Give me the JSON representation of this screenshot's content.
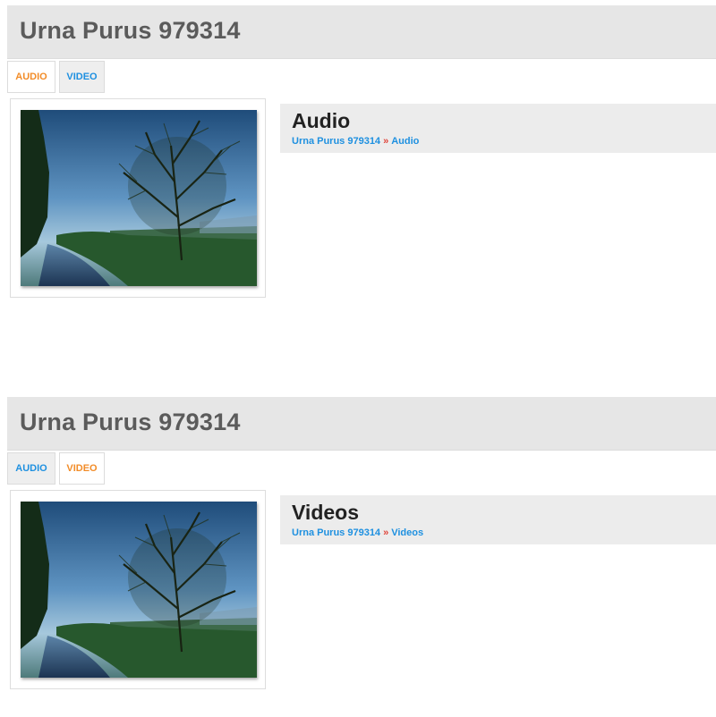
{
  "panels": [
    {
      "title": "Urna Purus 979314",
      "tabs": [
        {
          "label": "AUDIO",
          "active": true
        },
        {
          "label": "VIDEO",
          "active": false
        }
      ],
      "section_title": "Audio",
      "breadcrumb": {
        "home": "Urna Purus 979314",
        "separator": "»",
        "current": "Audio"
      }
    },
    {
      "title": "Urna Purus 979314",
      "tabs": [
        {
          "label": "AUDIO",
          "active": false
        },
        {
          "label": "VIDEO",
          "active": true
        }
      ],
      "section_title": "Videos",
      "breadcrumb": {
        "home": "Urna Purus 979314",
        "separator": "»",
        "current": "Videos"
      }
    }
  ],
  "colors": {
    "title_bar": "#e6e6e6",
    "title_text": "#5b5b5b",
    "tab_active_text": "#f28c28",
    "tab_inactive_text": "#1e90e0",
    "link": "#1e90e0",
    "separator": "#e0443a",
    "section_bar": "#ececec"
  },
  "icons": {
    "thumbnail": "landscape-tree-photo"
  }
}
